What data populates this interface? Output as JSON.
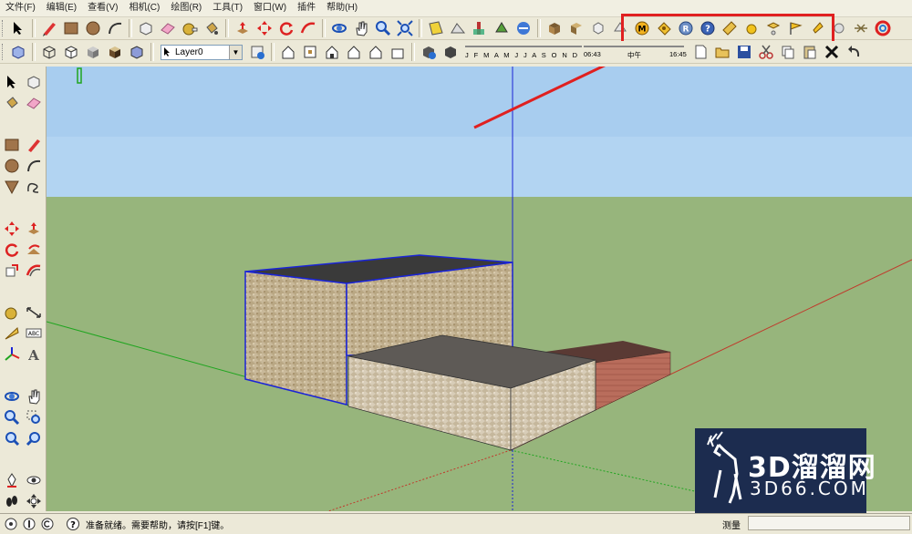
{
  "menu": [
    "文件(F)",
    "编辑(E)",
    "查看(V)",
    "相机(C)",
    "绘图(R)",
    "工具(T)",
    "窗口(W)",
    "插件",
    "帮助(H)"
  ],
  "layer": {
    "current": "Layer0"
  },
  "shadow": {
    "months": "J F M A M J J A S O N D",
    "time_start": "06:43",
    "noon": "中午",
    "time_end": "16:45"
  },
  "highlight": {
    "color": "#e02020"
  },
  "watermark": {
    "brand": "3D溜溜网",
    "domain": "3D66.COM"
  },
  "status": {
    "message": "准备就绪。需要帮助，请按[F1]键。",
    "measure_label": "测量",
    "measure_value": ""
  },
  "colors": {
    "sky": "#a8cdef",
    "ground": "#97b57c",
    "selection": "#1a24d6",
    "red_axis": "#c0392b",
    "green_axis": "#1fa51f",
    "blue_axis": "#1a24d6"
  }
}
